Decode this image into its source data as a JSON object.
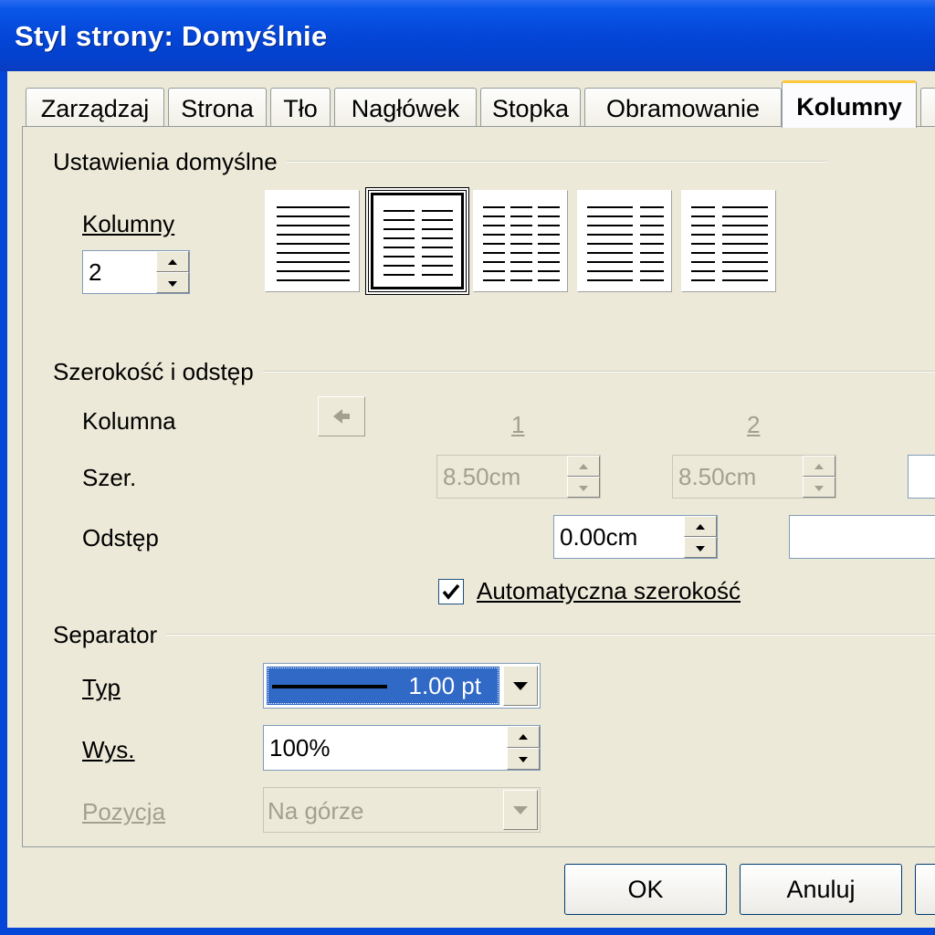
{
  "window": {
    "title": "Styl strony: Domyślnie"
  },
  "tabs": [
    "Zarządzaj",
    "Strona",
    "Tło",
    "Nagłówek",
    "Stopka",
    "Obramowanie",
    "Kolumny"
  ],
  "active_tab": "Kolumny",
  "defaults": {
    "group_label": "Ustawienia domyślne",
    "columns_label": "Kolumny",
    "columns_value": "2",
    "layout_options": [
      {
        "icon": "one-column-layout-icon",
        "selected": false
      },
      {
        "icon": "two-column-layout-icon",
        "selected": true
      },
      {
        "icon": "three-column-layout-icon",
        "selected": false
      },
      {
        "icon": "wide-left-column-layout-icon",
        "selected": false
      },
      {
        "icon": "wide-right-column-layout-icon",
        "selected": false
      }
    ]
  },
  "width_spacing": {
    "group_label": "Szerokość i odstęp",
    "column_label": "Kolumna",
    "col_numbers": [
      "1",
      "2"
    ],
    "width_label": "Szer.",
    "width_values": [
      "8.50cm",
      "8.50cm"
    ],
    "spacing_label": "Odstęp",
    "spacing_value": "0.00cm",
    "auto_width_label": "Automatyczna szerokość",
    "auto_width_checked": true
  },
  "separator": {
    "group_label": "Separator",
    "type_label": "Typ",
    "type_value": "1.00 pt",
    "height_label": "Wys.",
    "height_value": "100%",
    "position_label": "Pozycja",
    "position_value": "Na górze"
  },
  "buttons": {
    "ok": "OK",
    "cancel": "Anuluj"
  },
  "colors": {
    "titlebar": "#0446d8",
    "selection": "#3169c6",
    "dialog_bg": "#ece9d8"
  }
}
